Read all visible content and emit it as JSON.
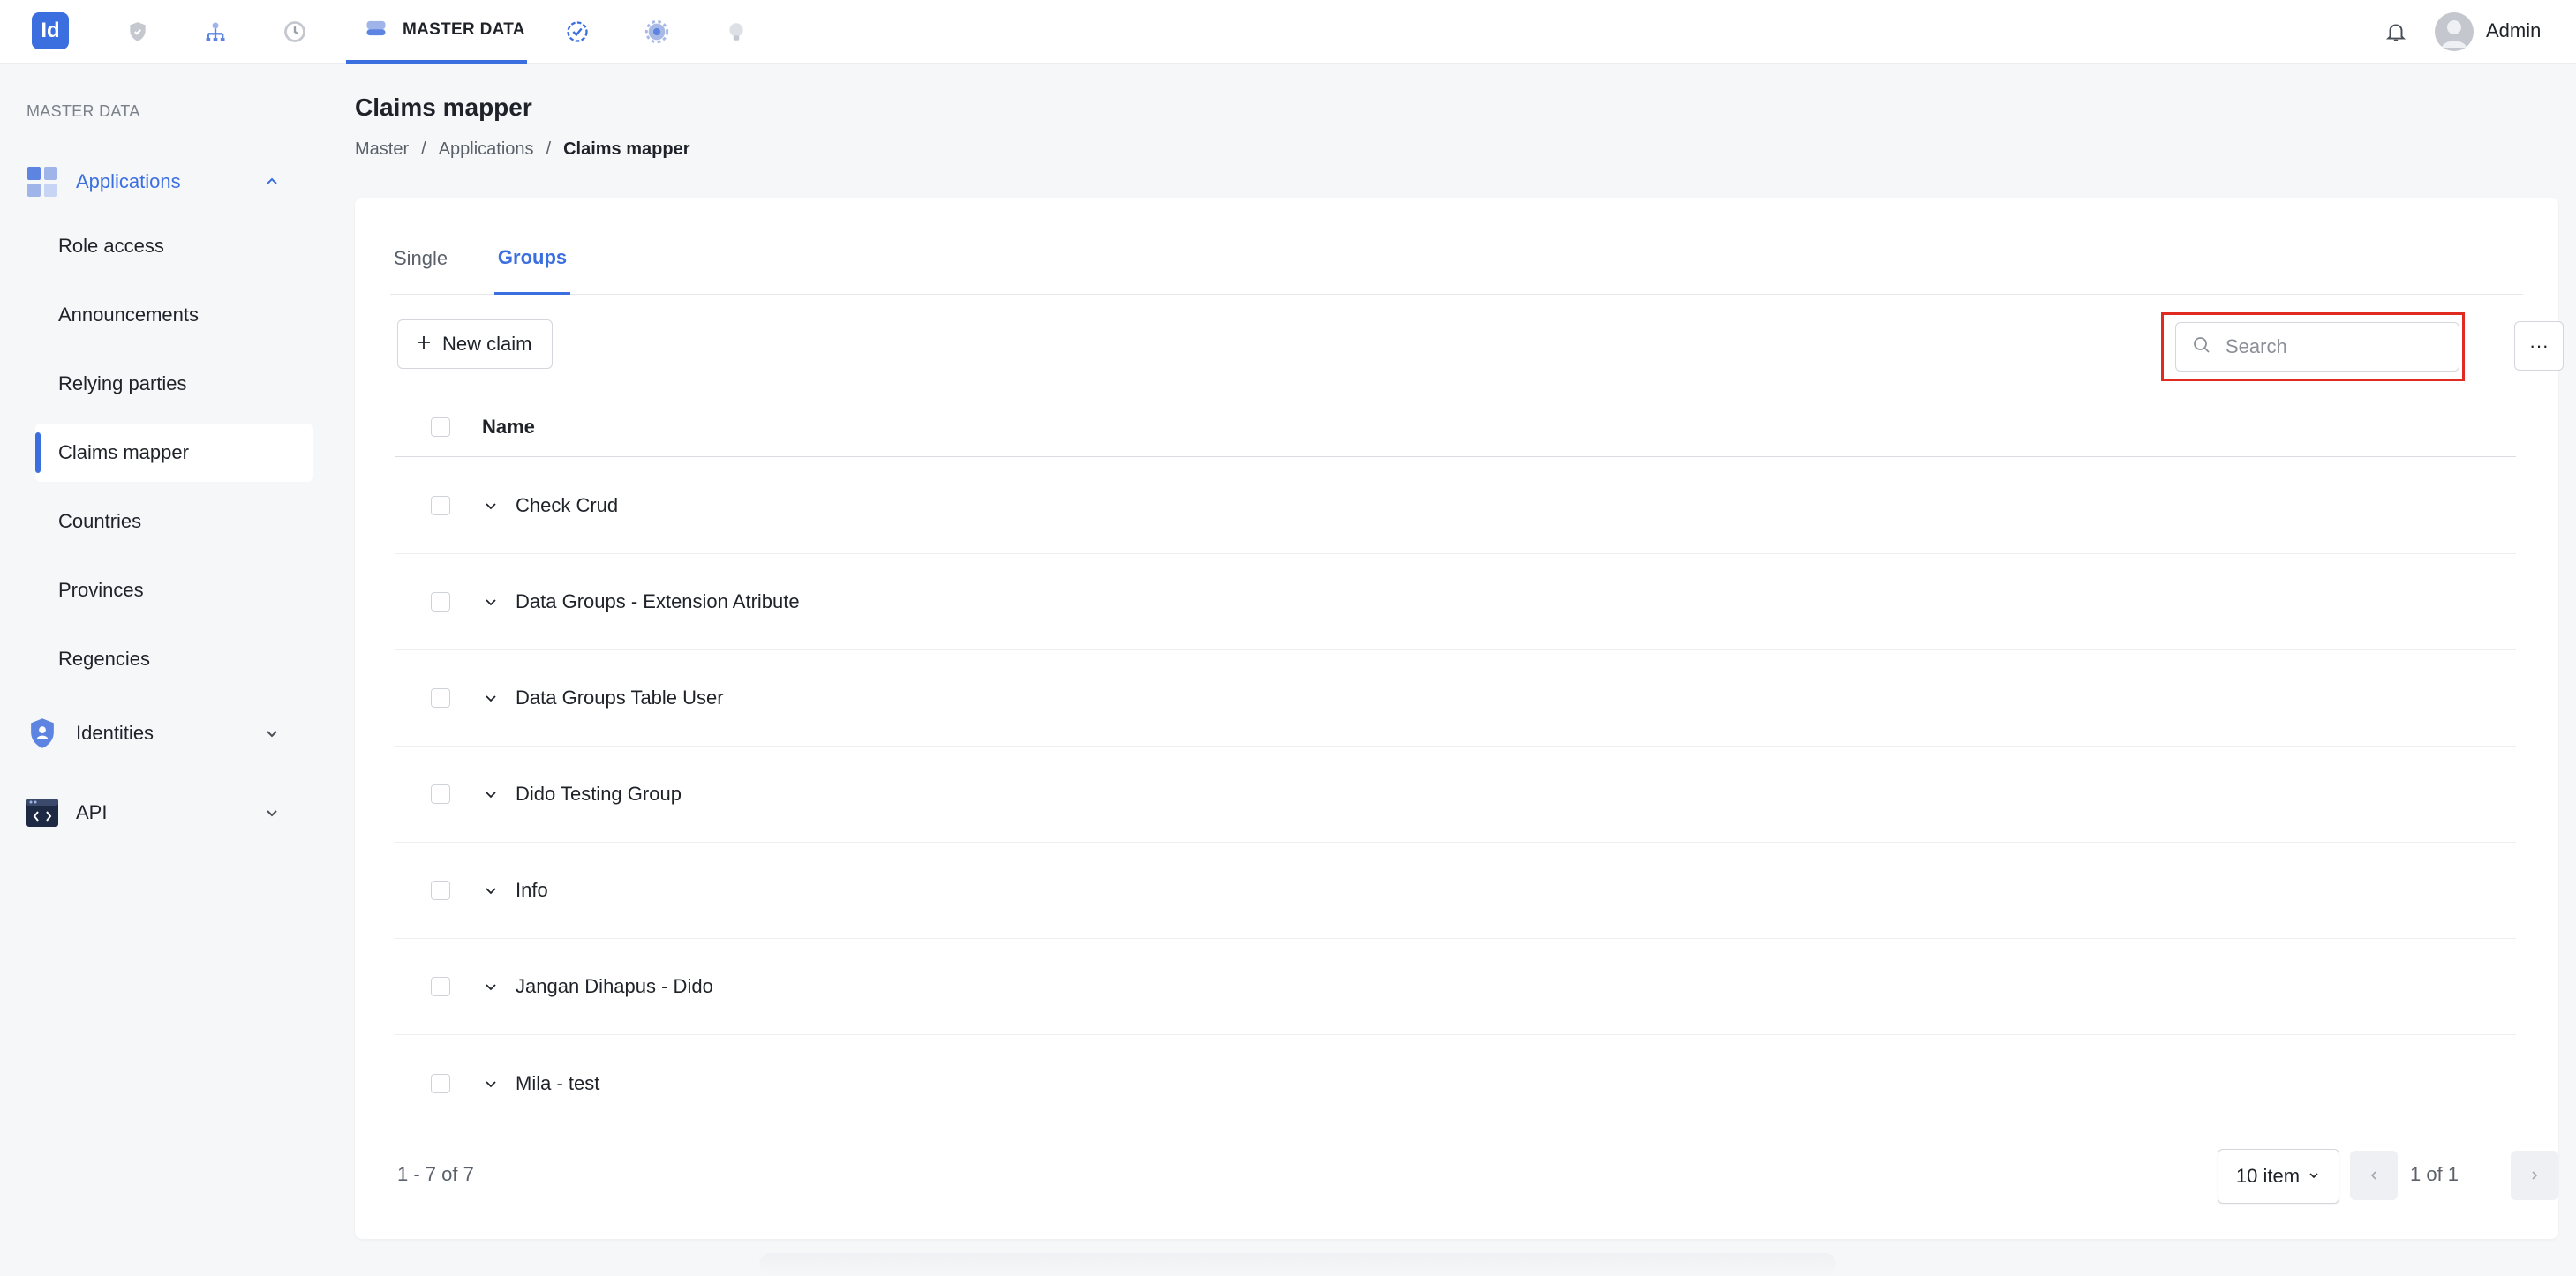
{
  "topbar": {
    "logo_text": "Id",
    "active_tab_label": "MASTER DATA",
    "username": "Admin",
    "nav_icons": [
      "shield-icon",
      "network-icon",
      "history-icon",
      "database-icon",
      "check-badge-icon",
      "gear-icon",
      "lightbulb-icon"
    ]
  },
  "sidebar": {
    "section_label": "MASTER DATA",
    "groups": {
      "applications": "Applications",
      "identities": "Identities",
      "api": "API"
    },
    "items": [
      "Role access",
      "Announcements",
      "Relying parties",
      "Claims mapper",
      "Countries",
      "Provinces",
      "Regencies"
    ],
    "active_item": "Claims mapper"
  },
  "page": {
    "title": "Claims mapper",
    "breadcrumb": [
      "Master",
      "Applications",
      "Claims mapper"
    ],
    "breadcrumb_sep": "/"
  },
  "tabs": [
    "Single",
    "Groups"
  ],
  "active_tab": "Groups",
  "toolbar": {
    "new_claim_label": "New claim",
    "search_placeholder": "Search",
    "search_value": "",
    "more_label": "···"
  },
  "table": {
    "column_name": "Name",
    "rows": [
      "Check Crud",
      "Data Groups - Extension Atribute",
      "Data Groups Table User",
      "Dido Testing Group",
      "Info",
      "Jangan Dihapus - Dido",
      "Mila - test"
    ]
  },
  "footer": {
    "count": "1 - 7 of 7",
    "page_size": "10 item",
    "page": "1 of 1"
  },
  "colors": {
    "accent": "#3b6fe0",
    "highlight": "#e02b20"
  }
}
